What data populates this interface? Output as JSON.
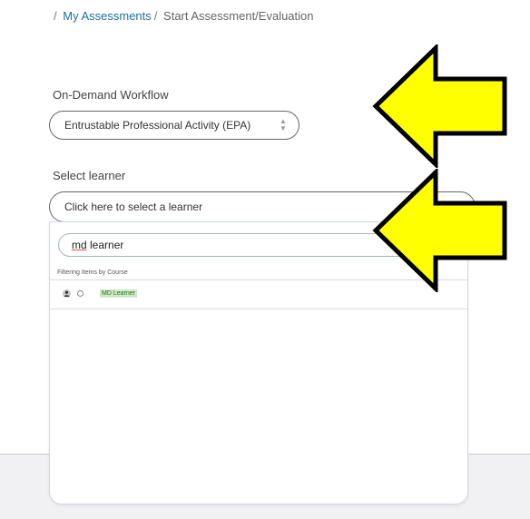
{
  "breadcrumb": {
    "separator": "/",
    "link": "My Assessments",
    "current": "Start Assessment/Evaluation"
  },
  "workflow": {
    "label": "On-Demand Workflow",
    "selected": "Entrustable Professional Activity (EPA)"
  },
  "learner": {
    "label": "Select learner",
    "placeholder": "Click here to select a learner"
  },
  "dropdown": {
    "search_prefix": "md",
    "search_suffix": " learner",
    "filter_note": "Filtering Items by Course",
    "results": [
      {
        "name": "MD Learner"
      }
    ]
  },
  "annotations": {
    "arrow_color": "#ffff00",
    "arrow_outline": "#000000"
  }
}
